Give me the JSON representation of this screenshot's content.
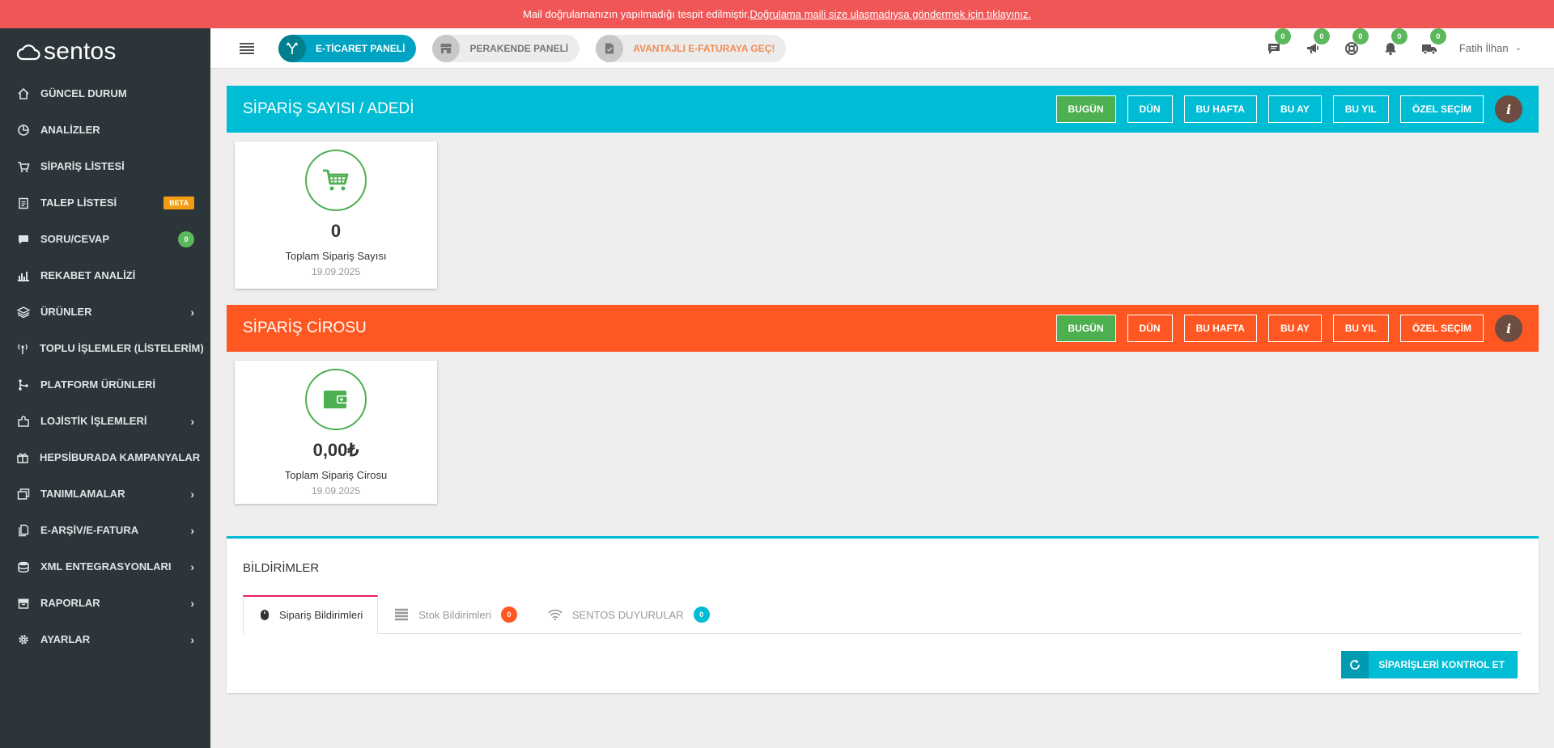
{
  "banner": {
    "text": "Mail doğrulamanızın yapılmadığı tespit edilmiştir.",
    "link": "Doğrulama maili size ulaşmadıysa göndermek için tıklayınız."
  },
  "logo": {
    "text": "sentos"
  },
  "sidebar": {
    "items": [
      {
        "label": "GÜNCEL DURUM",
        "icon": "home-icon"
      },
      {
        "label": "ANALİZLER",
        "icon": "pie-chart-icon"
      },
      {
        "label": "SİPARİŞ LİSTESİ",
        "icon": "cart-icon"
      },
      {
        "label": "TALEP LİSTESİ",
        "icon": "clipboard-icon",
        "badge": "BETA"
      },
      {
        "label": "SORU/CEVAP",
        "icon": "chat-icon",
        "count": "0"
      },
      {
        "label": "REKABET ANALİZİ",
        "icon": "bar-chart-icon"
      },
      {
        "label": "ÜRÜNLER",
        "icon": "layers-icon"
      },
      {
        "label": "TOPLU İŞLEMLER (LİSTELERİM)",
        "icon": "antenna-icon"
      },
      {
        "label": "PLATFORM ÜRÜNLERİ",
        "icon": "branch-icon"
      },
      {
        "label": "LOJİSTİK İŞLEMLERİ",
        "icon": "puzzle-icon"
      },
      {
        "label": "HEPSİBURADA KAMPANYALAR",
        "icon": "gift-icon"
      },
      {
        "label": "TANIMLAMALAR",
        "icon": "windows-icon"
      },
      {
        "label": "E-ARŞİV/E-FATURA",
        "icon": "document-icon"
      },
      {
        "label": "XML ENTEGRASYONLARI",
        "icon": "database-icon"
      },
      {
        "label": "RAPORLAR",
        "icon": "archive-icon"
      },
      {
        "label": "AYARLAR",
        "icon": "gear-icon"
      }
    ]
  },
  "header": {
    "pills": [
      {
        "label": "E-TİCARET PANELİ"
      },
      {
        "label": "PERAKENDE PANELİ"
      },
      {
        "label": "AVANTAJLI E-FATURAYA GEÇ!"
      }
    ],
    "counts": [
      "0",
      "0",
      "0",
      "0",
      "0"
    ],
    "user": "Fatih İlhan"
  },
  "orders": {
    "title": "SİPARİŞ SAYISI / ADEDİ",
    "filters": [
      "BUGÜN",
      "DÜN",
      "BU HAFTA",
      "BU AY",
      "BU YIL",
      "ÖZEL SEÇİM"
    ],
    "card": {
      "value": "0",
      "label": "Toplam Sipariş Sayısı",
      "date": "19.09.2025"
    }
  },
  "revenue": {
    "title": "SİPARİŞ CİROSU",
    "filters": [
      "BUGÜN",
      "DÜN",
      "BU HAFTA",
      "BU AY",
      "BU YIL",
      "ÖZEL SEÇİM"
    ],
    "card": {
      "value": "0,00₺",
      "label": "Toplam Sipariş Cirosu",
      "date": "19.09.2025"
    }
  },
  "notifications": {
    "title": "BİLDİRİMLER",
    "tabs": [
      {
        "label": "Sipariş Bildirimleri"
      },
      {
        "label": "Stok Bildirimleri",
        "count": "0"
      },
      {
        "label": "SENTOS DUYURULAR",
        "count": "0"
      }
    ],
    "button": "SİPARİŞLERİ KONTROL ET"
  },
  "colors": {
    "banner": "#f05656",
    "sidebar": "#2c3539",
    "cyan": "#00bcd4",
    "orange": "#ff5722",
    "green": "#4caf50"
  }
}
